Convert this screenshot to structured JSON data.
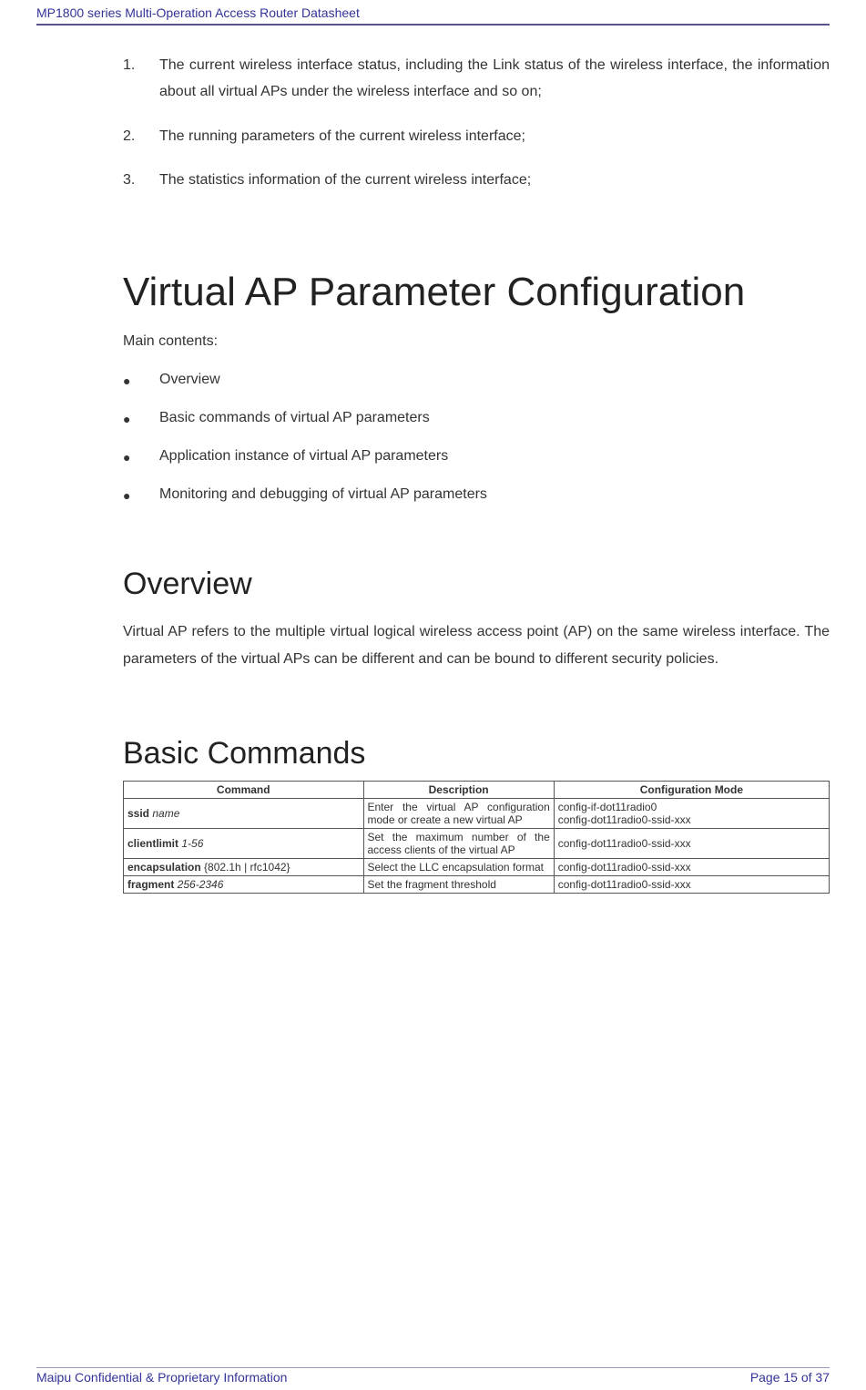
{
  "header": {
    "title": "MP1800 series Multi-Operation Access Router Datasheet"
  },
  "numbered": [
    {
      "n": "1.",
      "text": "The current wireless interface status, including the Link status of the wireless interface, the information about all virtual APs under the wireless interface and so on;"
    },
    {
      "n": "2.",
      "text": "The running parameters of the current wireless interface;"
    },
    {
      "n": "3.",
      "text": "The statistics information of the current wireless interface;"
    }
  ],
  "chapter_title": "Virtual AP Parameter Configuration",
  "main_contents_label": "Main contents:",
  "bullets": [
    "Overview",
    "Basic commands of virtual AP parameters",
    "Application instance of virtual AP parameters",
    "Monitoring and debugging of virtual AP parameters"
  ],
  "overview": {
    "heading": "Overview",
    "body": "Virtual AP refers to the multiple virtual logical wireless access point (AP) on the same wireless interface. The parameters of the virtual APs can be different and can be bound to different security policies."
  },
  "basic": {
    "heading": "Basic Commands",
    "table": {
      "headers": {
        "c1": "Command",
        "c2": "Description",
        "c3": "Configuration Mode"
      },
      "rows": [
        {
          "cmd_bold": "ssid",
          "cmd_param": " name",
          "desc": "Enter the virtual AP configuration mode or create a new virtual AP",
          "mode": "config-if-dot11radio0\nconfig-dot11radio0-ssid-xxx"
        },
        {
          "cmd_bold": "clientlimit",
          "cmd_param": " 1-56",
          "desc": "Set the maximum number of the access clients of the virtual AP",
          "mode": "config-dot11radio0-ssid-xxx"
        },
        {
          "cmd_bold": "encapsulation",
          "cmd_plain": " {802.1h | rfc1042}",
          "desc": "Select the LLC encapsulation format",
          "mode": "config-dot11radio0-ssid-xxx"
        },
        {
          "cmd_bold": "fragment",
          "cmd_param": " 256-2346",
          "desc": "Set the fragment threshold",
          "mode": "config-dot11radio0-ssid-xxx"
        }
      ]
    }
  },
  "footer": {
    "left": "Maipu Confidential & Proprietary Information",
    "right": "Page 15 of 37"
  }
}
